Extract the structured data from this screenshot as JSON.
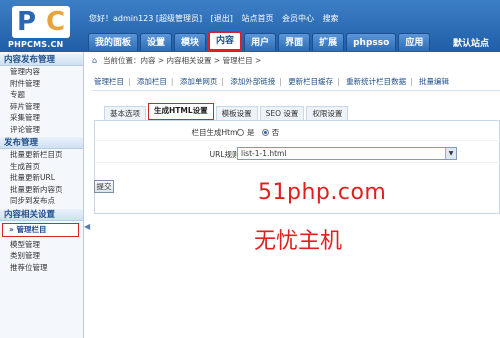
{
  "logo": {
    "text": "PHPCMS.CN"
  },
  "toplinks": {
    "greeting": "您好！admin123 [超级管理员]",
    "logout": "[退出]",
    "site_home": "站点首页",
    "member_center": "会员中心",
    "search": "搜索"
  },
  "mainnav": [
    "我的面板",
    "设置",
    "模块",
    "内容",
    "用户",
    "界面",
    "扩展",
    "phpsso",
    "应用"
  ],
  "site_switch": "默认站点",
  "sidebar": {
    "sections": [
      {
        "title": "内容发布管理",
        "items": [
          "管理内容",
          "附件管理",
          "专题",
          "碎片管理",
          "采集管理",
          "评论管理"
        ]
      },
      {
        "title": "发布管理",
        "items": [
          "批量更新栏目页",
          "生成首页",
          "批量更新URL",
          "批量更新内容页",
          "同步到发布点"
        ]
      },
      {
        "title": "内容相关设置",
        "items": [
          "管理栏目",
          "模型管理",
          "类别管理",
          "推荐位管理"
        ]
      }
    ],
    "active_item": "管理栏目"
  },
  "breadcrumb": "当前位置：内容 > 内容相关设置 > 管理栏目 >",
  "subnav": [
    "管理栏目",
    "添加栏目",
    "添加单网页",
    "添加外部链接",
    "更新栏目缓存",
    "重新统计栏目数据",
    "批量编辑"
  ],
  "tabs": [
    "基本选项",
    "生成HTML设置",
    "模板设置",
    "SEO 设置",
    "权限设置"
  ],
  "form": {
    "html_label": "栏目生成Html：",
    "yes": "是",
    "no": "否",
    "url_label": "URL规则：",
    "url_value": "list-1-1.html",
    "submit": "提交"
  },
  "watermark": {
    "line1": "51php.com",
    "line2": "无忧主机"
  },
  "colors": {
    "header_blue": "#1f5ea8",
    "highlight_red": "#d9232a"
  }
}
